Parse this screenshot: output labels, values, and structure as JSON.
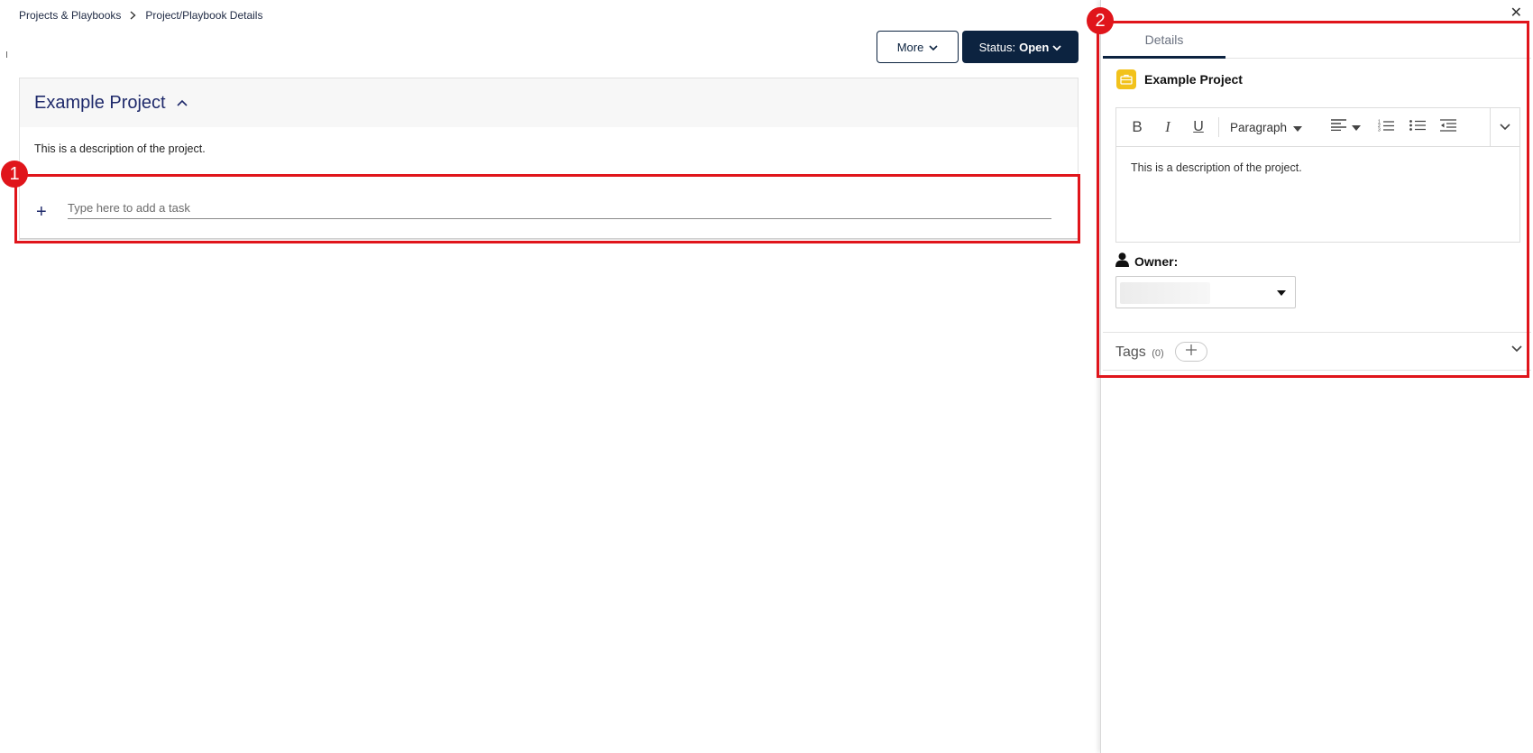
{
  "breadcrumb": {
    "items": [
      "Projects & Playbooks",
      "Project/Playbook Details"
    ]
  },
  "header": {
    "more_label": "More",
    "status_prefix": "Status:",
    "status_value": "Open"
  },
  "project": {
    "title": "Example Project",
    "description": "This is a description of the project."
  },
  "task_input": {
    "placeholder": "Type here to add a task",
    "value": ""
  },
  "annotations": [
    "1",
    "2"
  ],
  "panel": {
    "tab_details": "Details",
    "project_name": "Example Project",
    "toolbar": {
      "bold": "B",
      "italic": "I",
      "underline": "U",
      "paragraph": "Paragraph"
    },
    "editor_text": "This is a description of the project.",
    "owner_label": "Owner:",
    "tags_label": "Tags",
    "tags_count": "(0)"
  },
  "colors": {
    "navy": "#0c2340",
    "annotation_red": "#e0151b",
    "project_icon": "#f2c21b"
  }
}
